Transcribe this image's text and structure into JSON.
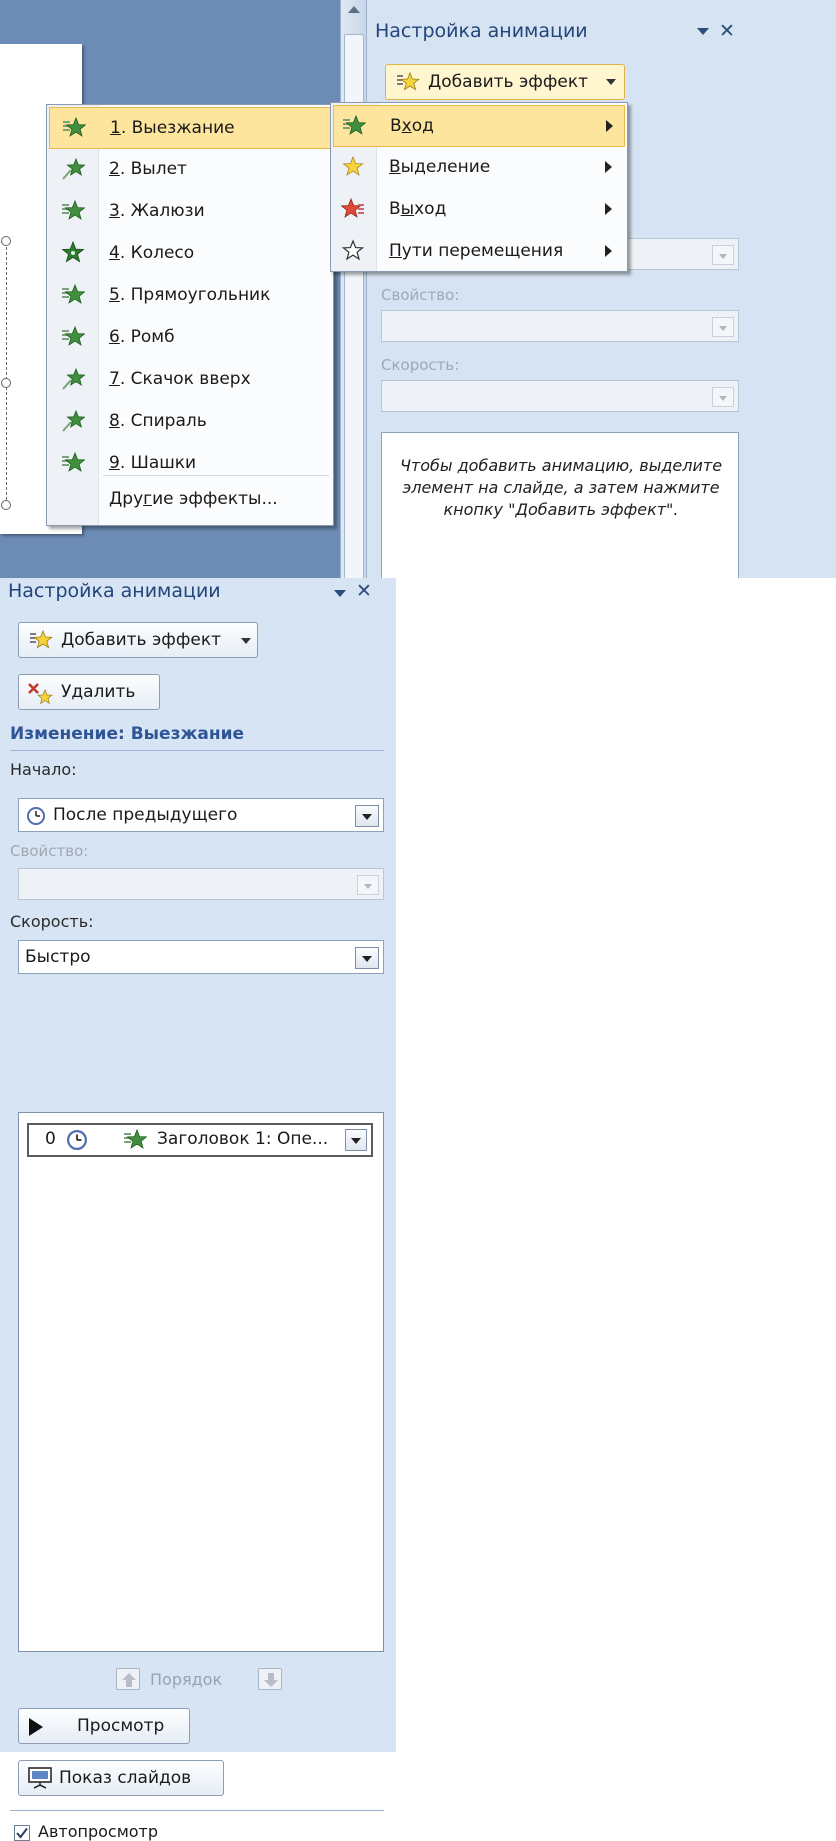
{
  "top": {
    "pane_title": "Настройка анимации",
    "add_effect": "Добавить эффект",
    "property_label": "Свойство:",
    "speed_label": "Скорость:",
    "hint": "Чтобы добавить анимацию, выделите элемент на слайде, а затем нажмите кнопку \"Добавить эффект\".",
    "effect_menu": [
      {
        "num": "1",
        "text": ". Выезжание"
      },
      {
        "num": "2",
        "text": ". Вылет"
      },
      {
        "num": "3",
        "text": ". Жалюзи"
      },
      {
        "num": "4",
        "text": ". Колесо"
      },
      {
        "num": "5",
        "text": ". Прямоугольник"
      },
      {
        "num": "6",
        "text": ". Ромб"
      },
      {
        "num": "7",
        "text": ". Скачок вверх"
      },
      {
        "num": "8",
        "text": ". Спираль"
      },
      {
        "num": "9",
        "text": ". Шашки"
      }
    ],
    "more_a": "Дру",
    "more_u": "г",
    "more_b": "ие эффекты...",
    "category_menu": [
      {
        "a": "В",
        "u": "х",
        "b": "од"
      },
      {
        "a": "",
        "u": "В",
        "b": "ыделение"
      },
      {
        "a": "В",
        "u": "ы",
        "b": "ход"
      },
      {
        "a": "",
        "u": "П",
        "b": "ути перемещения"
      }
    ]
  },
  "bottom": {
    "pane_title": "Настройка анимации",
    "add_effect": "Добавить эффект",
    "delete": "Удалить",
    "section_title": "Изменение: Выезжание",
    "start_label": "Начало:",
    "start_value": "После предыдущего",
    "property_label": "Свойство:",
    "speed_label": "Скорость:",
    "speed_value": "Быстро",
    "list_item_index": "0",
    "list_item_text": "Заголовок 1: Опе...",
    "order_label": "Порядок",
    "preview": "Просмотр",
    "slideshow": "Показ слайдов",
    "autopreview": "Автопросмотр",
    "autopreview_checked": true
  }
}
